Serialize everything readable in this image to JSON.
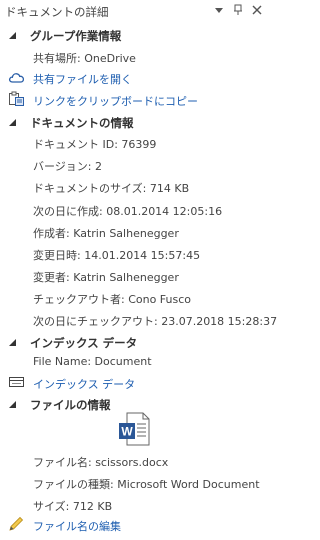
{
  "pane": {
    "title": "ドキュメントの詳細"
  },
  "group_section": {
    "header": "グループ作業情報",
    "shared_location": "共有場所:  OneDrive",
    "open_shared_file": "共有ファイルを開く",
    "copy_link": "リンクをクリップボードにコピー"
  },
  "doc_section": {
    "header": "ドキュメントの情報",
    "rows": [
      "ドキュメント ID: 76399",
      "バージョン: 2",
      "ドキュメントのサイズ: 714 KB",
      "次の日に作成: 08.01.2014 12:05:16",
      "作成者: Katrin Salhenegger",
      "変更日時: 14.01.2014 15:57:45",
      "変更者: Katrin Salhenegger",
      "チェックアウト者: Cono Fusco",
      "次の日にチェックアウト: 23.07.2018 15:28:37"
    ]
  },
  "index_section": {
    "header": "インデックス データ",
    "file_name": "File Name:  Document",
    "index_link": "インデックス データ"
  },
  "file_section": {
    "header": "ファイルの情報",
    "rows": [
      "ファイル名: scissors.docx",
      "ファイルの種類: Microsoft Word Document",
      "サイズ: 712 KB"
    ],
    "edit_link": "ファイル名の編集"
  },
  "colors": {
    "link": "#1e5eb0",
    "word": "#2b5797",
    "text": "#444444"
  }
}
